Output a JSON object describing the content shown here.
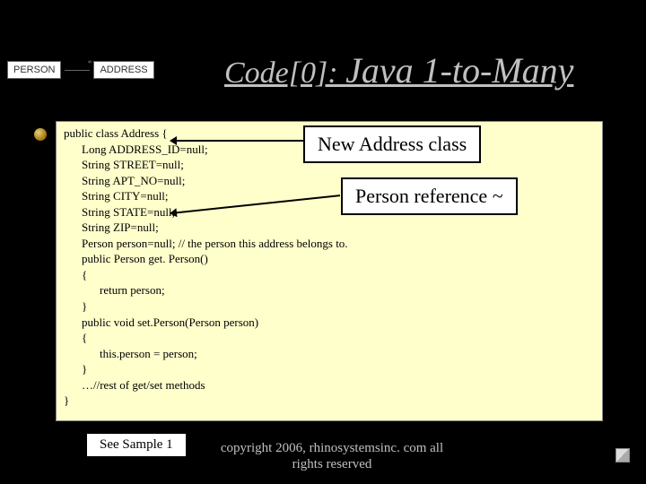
{
  "uml": {
    "left": "PERSON",
    "right": "ADDRESS",
    "mult": "*"
  },
  "title": {
    "prefix": "Code[0]: ",
    "main": "Java 1-to-Many"
  },
  "callout1": "New Address class",
  "callout2": "Person reference ~",
  "code": {
    "l1": "public class Address {",
    "l2": "Long ADDRESS_ID=null;",
    "l3": "String STREET=null;",
    "l4": "String APT_NO=null;",
    "l5": "String CITY=null;",
    "l6": "String STATE=null;",
    "l7": "String ZIP=null;",
    "l8": "Person person=null; // the person this address belongs to.",
    "l9": "public Person get. Person()",
    "l10": "{",
    "l11": "return person;",
    "l12": "}",
    "l13": "public void set.Person(Person person)",
    "l14": "{",
    "l15": "this.person = person;",
    "l16": "}",
    "l17": "…//rest of get/set methods",
    "l18": "}"
  },
  "footer_button": "See Sample 1",
  "footer_text": "copyright 2006, rhinosystemsinc. com all rights reserved"
}
